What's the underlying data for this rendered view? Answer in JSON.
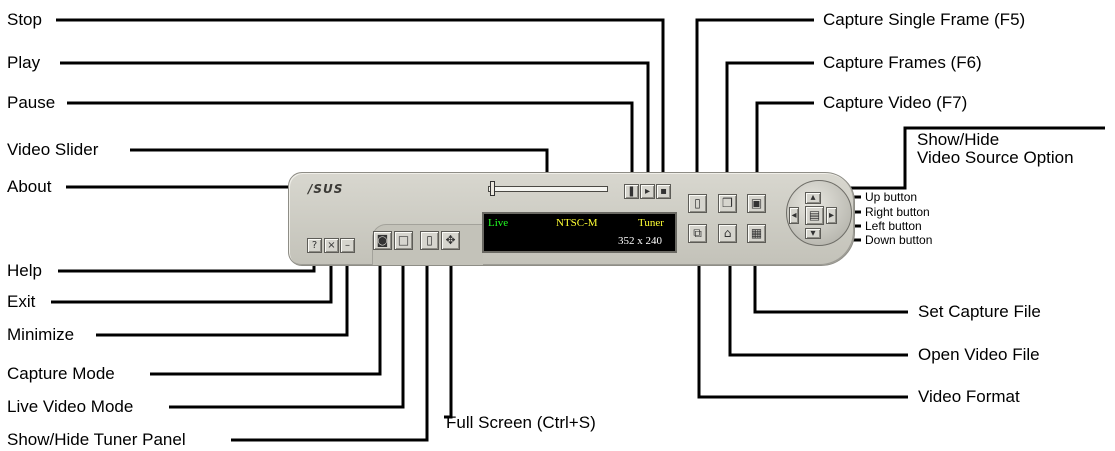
{
  "logo": "/SUS",
  "screen": {
    "mode": "Live",
    "standard": "NTSC-M",
    "source": "Tuner",
    "resolution": "352 x 240"
  },
  "labels": {
    "stop": "Stop",
    "play": "Play",
    "pause": "Pause",
    "video_slider": "Video Slider",
    "about": "About",
    "help": "Help",
    "exit": "Exit",
    "minimize": "Minimize",
    "capture_mode": "Capture Mode",
    "live_video_mode": "Live Video Mode",
    "show_hide_tuner": "Show/Hide Tuner Panel",
    "full_screen": "Full Screen (Ctrl+S)",
    "capture_single_frame": "Capture Single Frame (F5)",
    "capture_frames": "Capture Frames (F6)",
    "capture_video": "Capture Video (F7)",
    "show_hide_source_1": "Show/Hide",
    "show_hide_source_2": "Video Source Option",
    "up_button": "Up button",
    "right_button": "Right button",
    "left_button": "Left button",
    "down_button": "Down button",
    "set_capture_file": "Set Capture File",
    "open_video_file": "Open Video File",
    "video_format": "Video Format"
  },
  "icons": [
    "help-icon",
    "exit-icon",
    "minimize-icon",
    "capture-mode-icon",
    "live-video-icon",
    "tuner-panel-icon",
    "full-screen-icon",
    "pause-icon",
    "play-icon",
    "stop-icon",
    "capture-single-frame-icon",
    "capture-frames-icon",
    "capture-video-icon",
    "video-format-icon",
    "open-video-file-icon",
    "set-capture-file-icon",
    "video-source-icon",
    "up-arrow-icon",
    "right-arrow-icon",
    "left-arrow-icon",
    "down-arrow-icon"
  ],
  "colors": {
    "live": "#22ff22",
    "standard": "#ffff33",
    "panel": "#c9c8c0"
  }
}
